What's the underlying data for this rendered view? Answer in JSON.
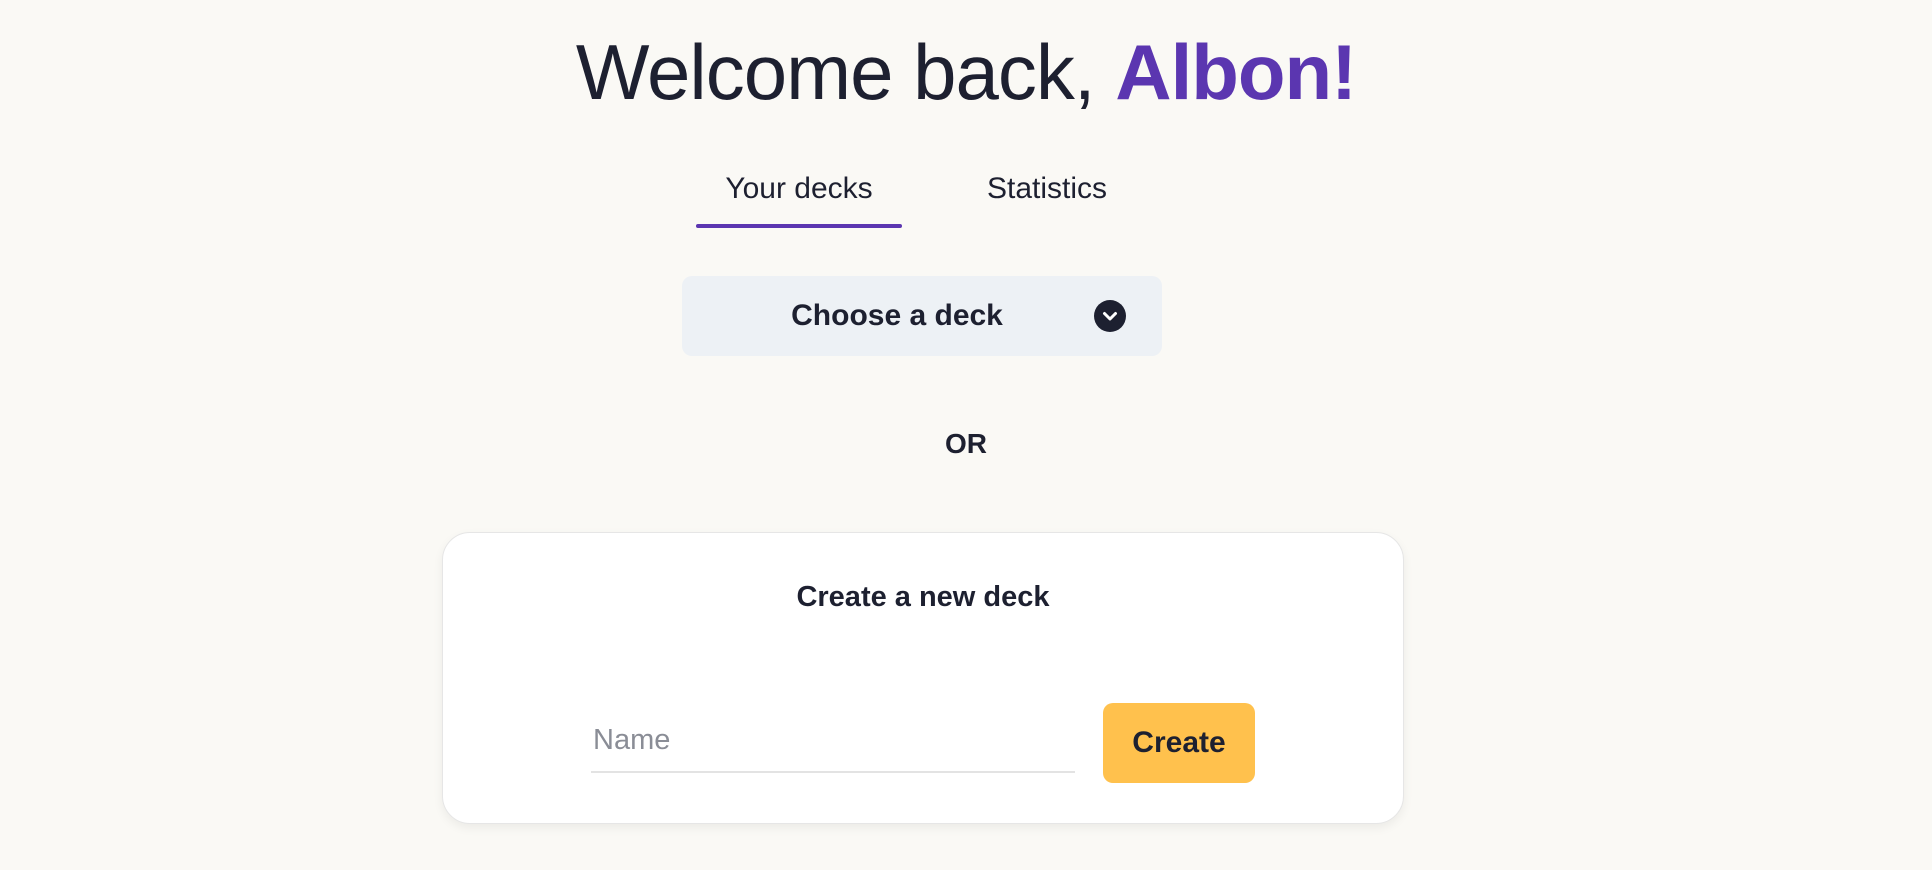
{
  "header": {
    "greeting_prefix": "Welcome back, ",
    "user_name": "Albon!"
  },
  "tabs": [
    {
      "label": "Your decks",
      "active": true
    },
    {
      "label": "Statistics",
      "active": false
    }
  ],
  "deck_select": {
    "label": "Choose a deck",
    "icon": "chevron-down-icon"
  },
  "separator": {
    "text": "OR"
  },
  "create_card": {
    "title": "Create a new deck",
    "name_placeholder": "Name",
    "name_value": "",
    "create_label": "Create"
  },
  "colors": {
    "background": "#faf9f5",
    "accent": "#5b36b0",
    "button": "#ffc14d",
    "select_bg": "#edf1f5",
    "text": "#1d2030"
  }
}
